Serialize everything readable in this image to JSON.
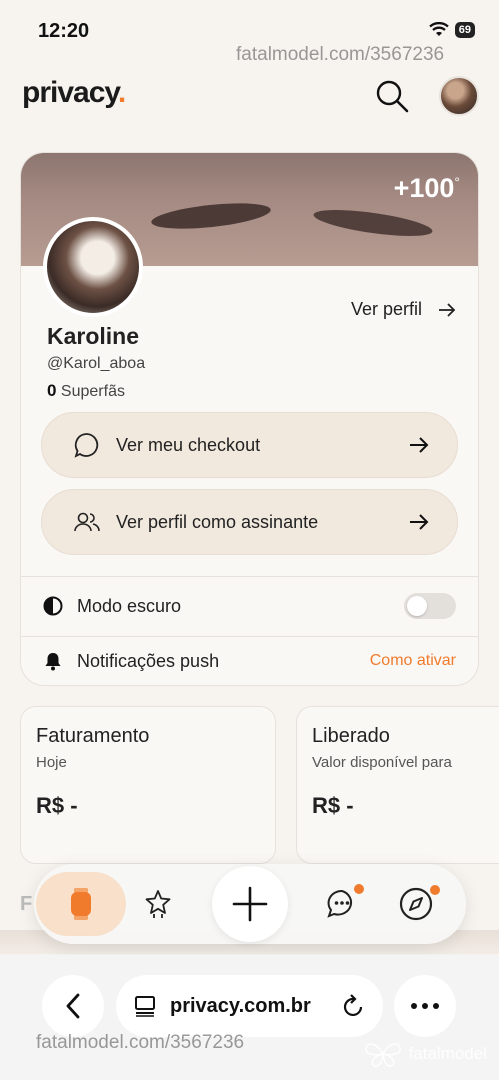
{
  "status": {
    "time": "12:20",
    "battery": "69"
  },
  "watermark": {
    "top": "fatalmodel.com/3567236",
    "bottom": "fatalmodel.com/3567236",
    "logo_text": "fatalmodel"
  },
  "header": {
    "logo": "privacy",
    "logo_dot": "."
  },
  "profile": {
    "followers_badge": "+100",
    "view_profile": "Ver perfil",
    "name": "Karoline",
    "handle": "@Karol_aboa",
    "fans_count": "0",
    "fans_label": "Superfãs"
  },
  "actions": {
    "checkout": "Ver meu checkout",
    "view_as_subscriber": "Ver perfil como assinante"
  },
  "settings": {
    "dark_mode": "Modo escuro",
    "push": "Notificações push",
    "push_action": "Como ativar"
  },
  "stats": [
    {
      "title": "Faturamento",
      "subtitle": "Hoje",
      "value": "R$ -"
    },
    {
      "title": "Liberado",
      "subtitle": "Valor disponível para",
      "value": "R$ -"
    }
  ],
  "behind": {
    "title_partial": "F"
  },
  "browser": {
    "url": "privacy.com.br"
  },
  "colors": {
    "accent": "#f07b2c",
    "background": "#f7f4f0",
    "pill": "#f1e8de"
  }
}
